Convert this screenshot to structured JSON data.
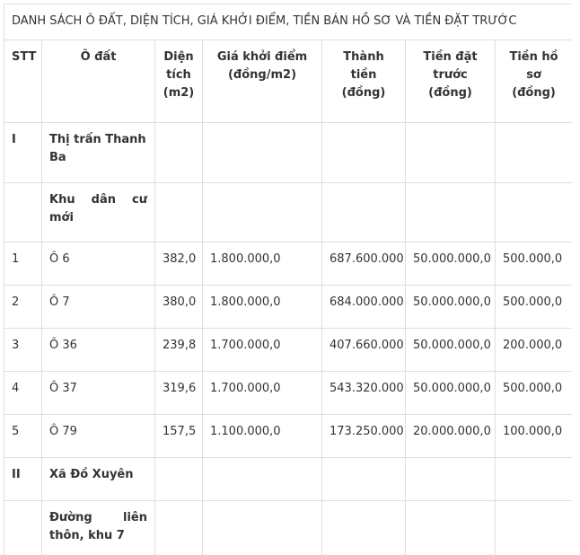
{
  "title": "DANH SÁCH Ô ĐẤT, DIỆN TÍCH, GIÁ KHỞI ĐIỂM, TIỀN BÁN HỒ SƠ VÀ TIỀN ĐẶT TRƯỚC",
  "headers": {
    "stt": "STT",
    "lot": "Ô đất",
    "area": "Diện tích (m2)",
    "start_price": "Giá khởi điểm (đồng/m2)",
    "total": "Thành tiền (đồng)",
    "deposit": "Tiền đặt trước (đồng)",
    "fee": "Tiền hồ sơ (đồng)"
  },
  "section1": {
    "num": "I",
    "name": "Thị trấn Thanh Ba",
    "sub_words": [
      "Khu",
      "dân",
      "cư"
    ],
    "sub_last": "mới"
  },
  "rows": [
    {
      "stt": "1",
      "lot": "Ô 6",
      "area": "382,0",
      "start_price": "1.800.000,0",
      "total": "687.600.000",
      "deposit": "50.000.000,0",
      "fee": "500.000,0"
    },
    {
      "stt": "2",
      "lot": "Ô 7",
      "area": "380,0",
      "start_price": "1.800.000,0",
      "total": "684.000.000",
      "deposit": "50.000.000,0",
      "fee": "500.000,0"
    },
    {
      "stt": "3",
      "lot": "Ô 36",
      "area": "239,8",
      "start_price": "1.700.000,0",
      "total": "407.660.000",
      "deposit": "50.000.000,0",
      "fee": "200.000,0"
    },
    {
      "stt": "4",
      "lot": "Ô 37",
      "area": "319,6",
      "start_price": "1.700.000,0",
      "total": "543.320.000",
      "deposit": "50.000.000,0",
      "fee": "500.000,0"
    },
    {
      "stt": "5",
      "lot": "Ô 79",
      "area": "157,5",
      "start_price": "1.100.000,0",
      "total": "173.250.000",
      "deposit": "20.000.000,0",
      "fee": "100.000,0"
    }
  ],
  "section2": {
    "num": "II",
    "name": "Xã Đồ Xuyên",
    "sub_words": [
      "Đường",
      "liên"
    ],
    "sub_last": "thôn, khu 7"
  }
}
